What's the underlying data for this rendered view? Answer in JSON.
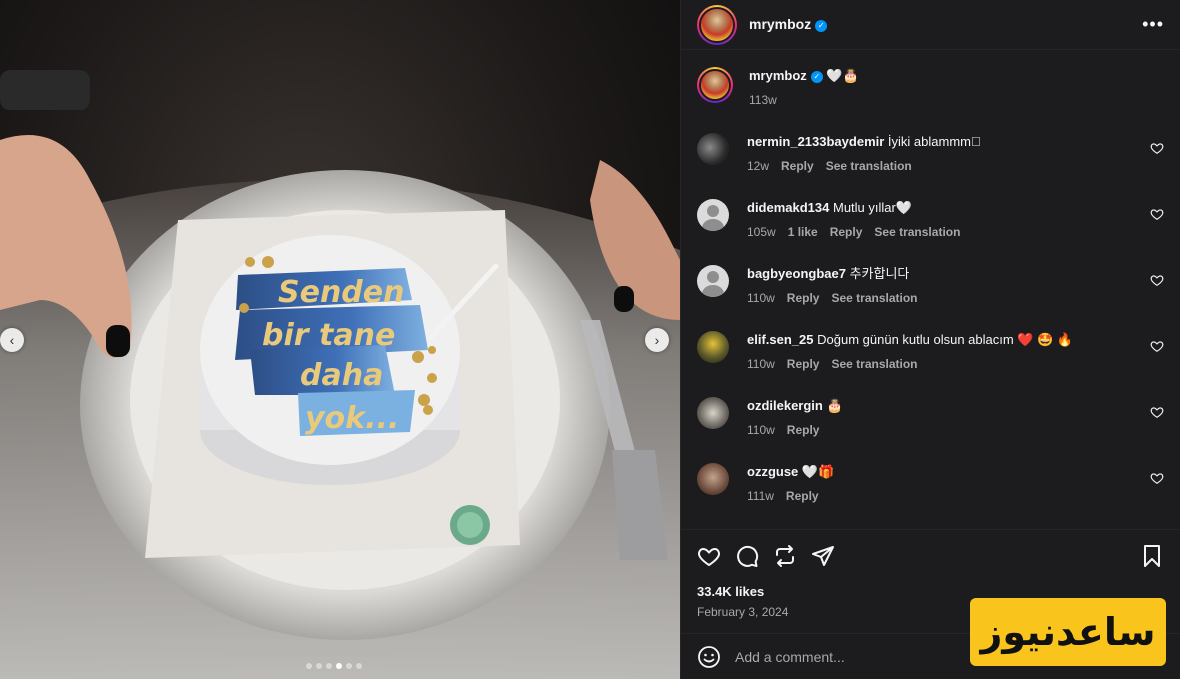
{
  "post": {
    "username": "mrymboz",
    "more_icon": "more-horizontal-icon",
    "caption": "🤍🎂",
    "caption_time": "113w",
    "likes": "33.4K likes",
    "date": "February 3, 2024"
  },
  "carousel": {
    "slide_count": 6,
    "active_index": 3
  },
  "cake_text": {
    "line1": "Senden",
    "line2": "bir tane",
    "line3": "daha",
    "line4": "yok..."
  },
  "comments": [
    {
      "user": "nermin_2133baydemir",
      "text": "İyiki ablammm\u0000",
      "time": "12w",
      "likes": "",
      "reply": "Reply",
      "translate": "See translation"
    },
    {
      "user": "didemakd134",
      "text": "Mutlu yıllar🤍",
      "time": "105w",
      "likes": "1 like",
      "reply": "Reply",
      "translate": "See translation"
    },
    {
      "user": "bagbyeongbae7",
      "text": "추카합니다",
      "time": "110w",
      "likes": "",
      "reply": "Reply",
      "translate": "See translation"
    },
    {
      "user": "elif.sen_25",
      "text": "Doğum günün kutlu olsun ablacım ❤️ 🤩 🔥",
      "time": "110w",
      "likes": "",
      "reply": "Reply",
      "translate": "See translation"
    },
    {
      "user": "ozdilekergin",
      "text": "🎂",
      "time": "110w",
      "likes": "",
      "reply": "Reply",
      "translate": ""
    },
    {
      "user": "ozzguse",
      "text": "🤍🎁",
      "time": "111w",
      "likes": "",
      "reply": "Reply",
      "translate": ""
    }
  ],
  "composer": {
    "placeholder": "Add a comment..."
  },
  "watermark": {
    "text": "ساعدنیوز"
  },
  "colors": {
    "panel_bg": "#1c1c1e",
    "verified": "#0095f6",
    "watermark_bg": "#f9c41b"
  }
}
